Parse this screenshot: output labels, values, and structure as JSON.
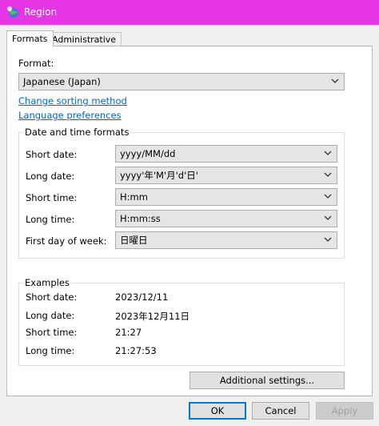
{
  "window": {
    "title": "Region"
  },
  "tabs": [
    {
      "label": "Formats",
      "active": true
    },
    {
      "label": "Administrative",
      "active": false
    }
  ],
  "format": {
    "label": "Format:",
    "value": "Japanese (Japan)",
    "change_sorting_link": "Change sorting method",
    "language_prefs_link": "Language preferences"
  },
  "date_time": {
    "title": "Date and time formats",
    "rows": [
      {
        "label": "Short date:",
        "value": "yyyy/MM/dd"
      },
      {
        "label": "Long date:",
        "value": "yyyy'年'M'月'd'日'"
      },
      {
        "label": "Short time:",
        "value": "H:mm"
      },
      {
        "label": "Long time:",
        "value": "H:mm:ss"
      },
      {
        "label": "First day of week:",
        "value": "日曜日"
      }
    ]
  },
  "examples": {
    "title": "Examples",
    "rows": [
      {
        "label": "Short date:",
        "value": "2023/12/11"
      },
      {
        "label": "Long date:",
        "value": "2023年12月11日"
      },
      {
        "label": "Short time:",
        "value": "21:27"
      },
      {
        "label": "Long time:",
        "value": "21:27:53"
      }
    ]
  },
  "buttons": {
    "additional": "Additional settings...",
    "ok": "OK",
    "cancel": "Cancel",
    "apply": "Apply"
  },
  "colors": {
    "titlebar": "#e535e5",
    "link": "#0066cc",
    "focus": "#0078d7"
  },
  "icons": {
    "app": "globe-icon",
    "dropdown": "chevron-down-icon"
  }
}
